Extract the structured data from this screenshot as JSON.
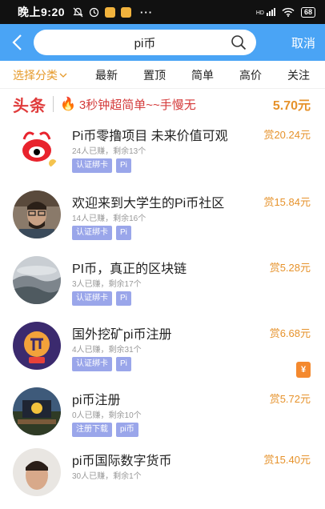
{
  "status_bar": {
    "time": "晚上9:20",
    "dots": "···",
    "signal": "HD",
    "battery": "68"
  },
  "header": {
    "back_icon": "chevron-left-icon",
    "search_value": "pi币",
    "search_icon": "search-icon",
    "cancel_label": "取消"
  },
  "tabs": [
    "选择分类",
    "最新",
    "置顶",
    "简单",
    "高价",
    "关注"
  ],
  "banner": {
    "logo": "头条",
    "title": "3秒钟超简单~~手慢无",
    "reward": "5.70元"
  },
  "items": [
    {
      "title": "Pi币零撸项目 未来价值可观",
      "reward": "赏20.24元",
      "meta": "24人已赚，剩余13个",
      "tags": [
        "认证绑卡",
        "Pi"
      ]
    },
    {
      "title": "欢迎来到大学生的Pi币社区",
      "reward": "赏15.84元",
      "meta": "14人已赚，剩余16个",
      "tags": [
        "认证绑卡",
        "Pi"
      ]
    },
    {
      "title": "PI币，真正的区块链",
      "reward": "赏5.28元",
      "meta": "3人已赚，剩余17个",
      "tags": [
        "认证绑卡",
        "Pi"
      ]
    },
    {
      "title": "国外挖矿pi币注册",
      "reward": "赏6.68元",
      "meta": "4人已赚，剩余31个",
      "tags": [
        "认证绑卡",
        "Pi"
      ],
      "badge": "¥"
    },
    {
      "title": "pi币注册",
      "reward": "赏5.72元",
      "meta": "0人已赚，剩余10个",
      "tags": [
        "注册下载",
        "pi币"
      ]
    },
    {
      "title": "pi币国际数字货币",
      "reward": "赏15.40元",
      "meta": "30人已赚，剩余1个",
      "tags": []
    }
  ],
  "colors": {
    "accent": "#4aa4f5",
    "reward": "#e6922b",
    "tag": "#9aa6ea",
    "headline": "#e03c3c"
  }
}
